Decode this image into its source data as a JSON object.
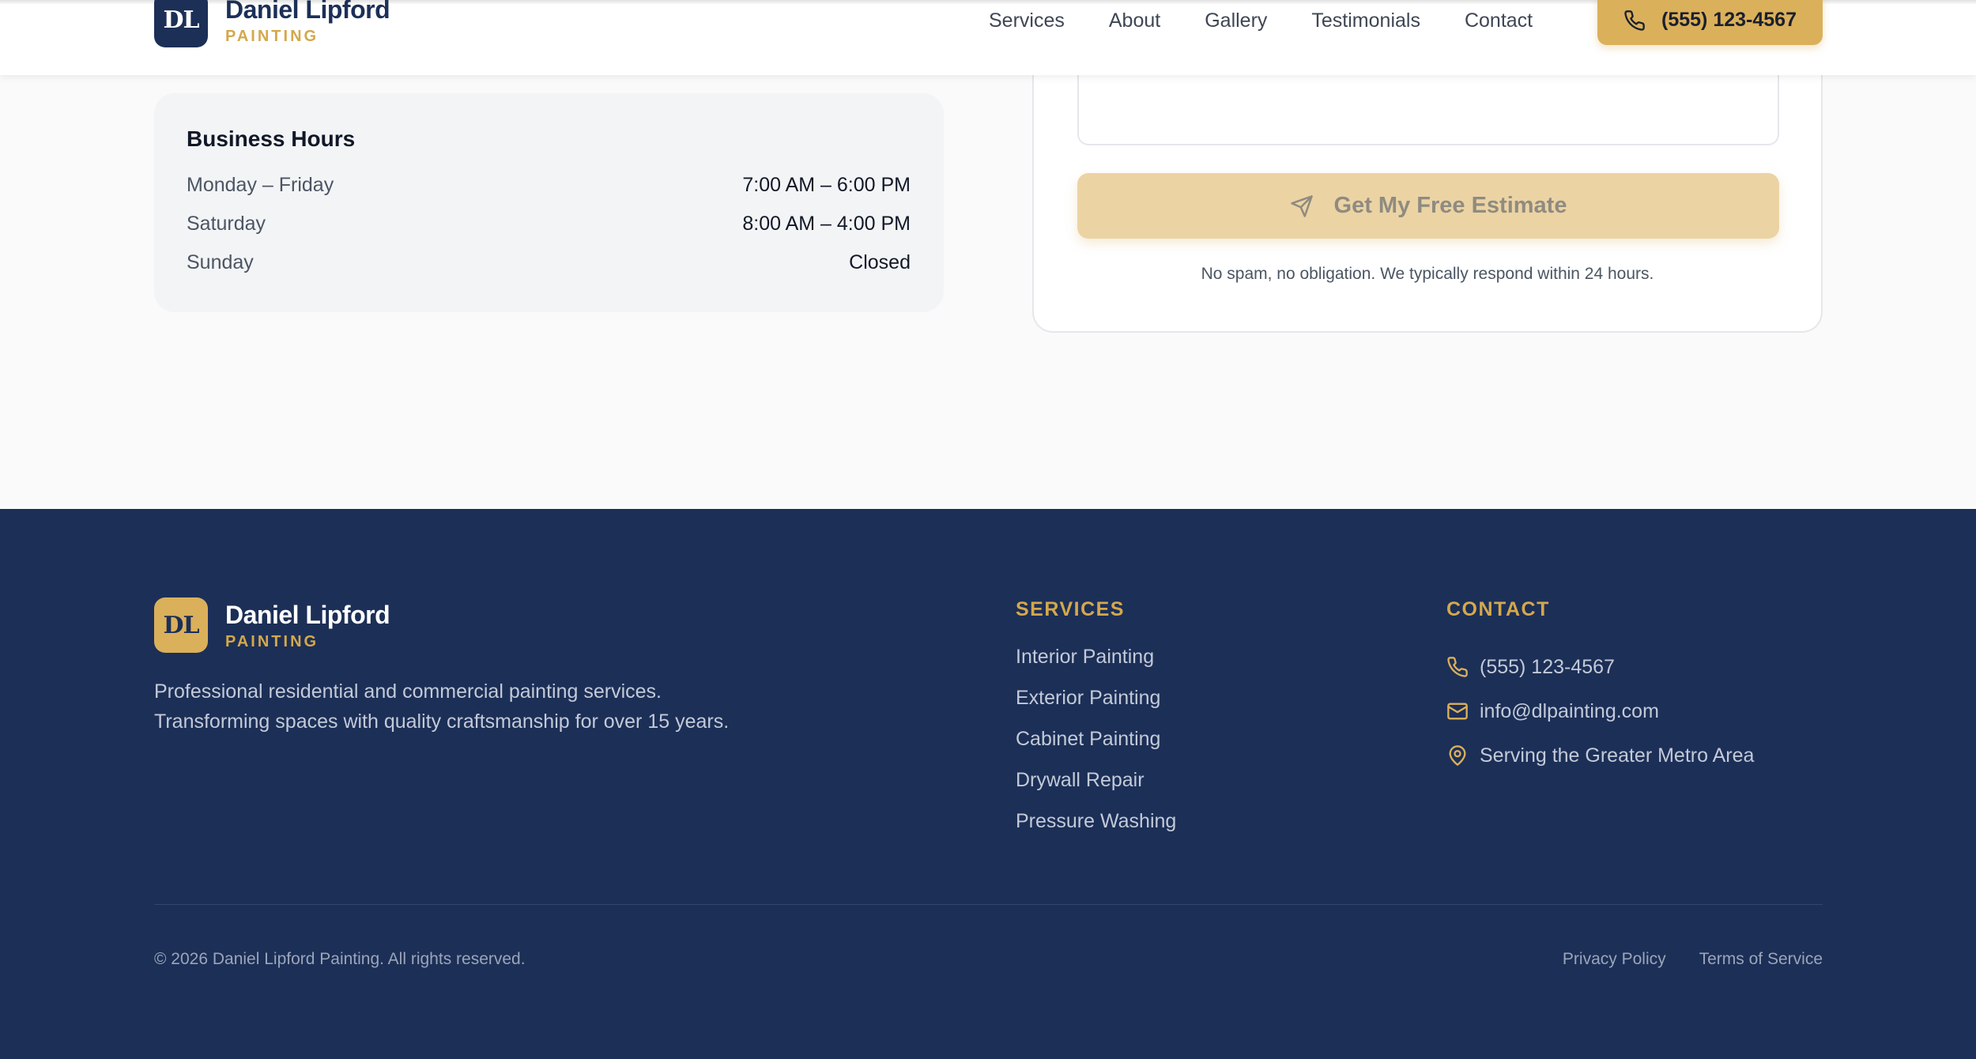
{
  "colors": {
    "navy": "#1c2f57",
    "gold": "#dbb05b",
    "gold_light": "#ecd3a4"
  },
  "header": {
    "logo_text": "DL",
    "brand_name": "Daniel Lipford",
    "brand_sub": "PAINTING",
    "nav": [
      "Services",
      "About",
      "Gallery",
      "Testimonials",
      "Contact"
    ],
    "phone_label": "(555) 123-4567",
    "phone_icon": "phone-icon"
  },
  "hours": {
    "title": "Business Hours",
    "rows": [
      {
        "day": "Monday – Friday",
        "time": "7:00 AM – 6:00 PM"
      },
      {
        "day": "Saturday",
        "time": "8:00 AM – 4:00 PM"
      },
      {
        "day": "Sunday",
        "time": "Closed"
      }
    ]
  },
  "form": {
    "submit_label": "Get My Free Estimate",
    "submit_icon": "send-icon",
    "note": "No spam, no obligation. We typically respond within 24 hours."
  },
  "footer": {
    "logo_text": "DL",
    "brand_name": "Daniel Lipford",
    "brand_sub": "PAINTING",
    "description_line1": "Professional residential and commercial painting services.",
    "description_line2": "Transforming spaces with quality craftsmanship for over 15 years.",
    "services_title": "SERVICES",
    "services": [
      "Interior Painting",
      "Exterior Painting",
      "Cabinet Painting",
      "Drywall Repair",
      "Pressure Washing"
    ],
    "contact_title": "CONTACT",
    "contact": [
      {
        "icon": "phone-icon",
        "text": "(555) 123-4567"
      },
      {
        "icon": "mail-icon",
        "text": "info@dlpainting.com"
      },
      {
        "icon": "map-pin-icon",
        "text": "Serving the Greater Metro Area"
      }
    ],
    "copyright": "© 2026 Daniel Lipford Painting. All rights reserved.",
    "legal": [
      "Privacy Policy",
      "Terms of Service"
    ]
  }
}
